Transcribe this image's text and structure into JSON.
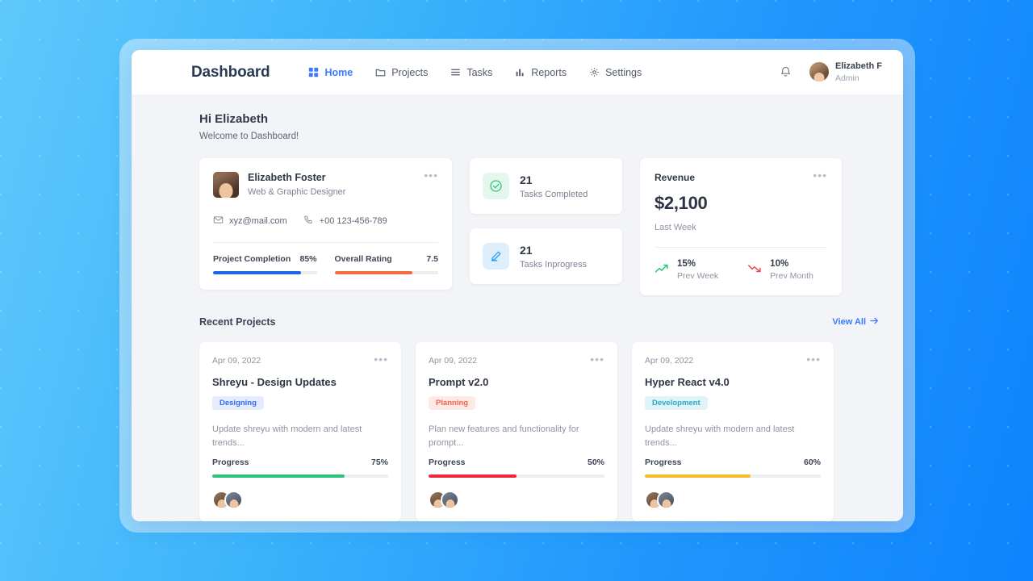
{
  "header": {
    "brand": "Dashboard",
    "nav": [
      {
        "label": "Home",
        "icon": "grid-icon",
        "active": true
      },
      {
        "label": "Projects",
        "icon": "folder-icon",
        "active": false
      },
      {
        "label": "Tasks",
        "icon": "list-icon",
        "active": false
      },
      {
        "label": "Reports",
        "icon": "bar-chart-icon",
        "active": false
      },
      {
        "label": "Settings",
        "icon": "gear-icon",
        "active": false
      }
    ],
    "notification_icon": "bell-icon",
    "user": {
      "name": "Elizabeth F",
      "role": "Admin",
      "avatar": "user-avatar"
    }
  },
  "greeting": {
    "title": "Hi Elizabeth",
    "subtitle": "Welcome to Dashboard!"
  },
  "profile": {
    "name": "Elizabeth Foster",
    "role": "Web & Graphic Designer",
    "email": "xyz@mail.com",
    "phone": "+00 123-456-789",
    "menu_icon": "more-horizontal-icon",
    "stats": [
      {
        "label": "Project Completion",
        "value": "85%",
        "percent": 85,
        "color": "#1f64e8"
      },
      {
        "label": "Overall Rating",
        "value": "7.5",
        "percent": 75,
        "color": "#f56a41"
      }
    ]
  },
  "task_cards": [
    {
      "count": "21",
      "label": "Tasks Completed",
      "icon": "check-circle-icon",
      "icon_color": "#2ec27e",
      "bg": "#e4f7ec"
    },
    {
      "count": "21",
      "label": "Tasks Inprogress",
      "icon": "pencil-icon",
      "icon_color": "#2a9df4",
      "bg": "#ddeffc"
    }
  ],
  "revenue": {
    "title": "Revenue",
    "amount": "$2,100",
    "period": "Last Week",
    "menu_icon": "more-horizontal-icon",
    "trends": [
      {
        "percent": "15%",
        "label": "Prev Week",
        "direction": "up",
        "icon": "trend-up-icon",
        "color": "#2ec27e"
      },
      {
        "percent": "10%",
        "label": "Prev Month",
        "direction": "down",
        "icon": "trend-down-icon",
        "color": "#f2414e"
      }
    ]
  },
  "recent_projects": {
    "title": "Recent Projects",
    "view_all": "View All",
    "view_all_icon": "arrow-right-icon",
    "items": [
      {
        "date": "Apr 09, 2022",
        "title": "Shreyu - Design Updates",
        "badge": "Designing",
        "badge_color": "#2f6bf5",
        "badge_bg": "#e4ecfe",
        "description": "Update shreyu with modern and latest trends...",
        "progress_label": "Progress",
        "progress_value": "75%",
        "progress_percent": 75,
        "progress_color": "#2ec27e",
        "menu_icon": "more-horizontal-icon"
      },
      {
        "date": "Apr 09, 2022",
        "title": "Prompt v2.0",
        "badge": "Planning",
        "badge_color": "#f2614c",
        "badge_bg": "#fdeae6",
        "description": "Plan new features and functionality for prompt...",
        "progress_label": "Progress",
        "progress_value": "50%",
        "progress_percent": 50,
        "progress_color": "#f0263c",
        "menu_icon": "more-horizontal-icon"
      },
      {
        "date": "Apr 09, 2022",
        "title": "Hyper React v4.0",
        "badge": "Development",
        "badge_color": "#2aa9c4",
        "badge_bg": "#e0f3f8",
        "description": "Update shreyu with modern and latest trends...",
        "progress_label": "Progress",
        "progress_value": "60%",
        "progress_percent": 60,
        "progress_color": "#f5bc2b",
        "menu_icon": "more-horizontal-icon"
      }
    ]
  }
}
